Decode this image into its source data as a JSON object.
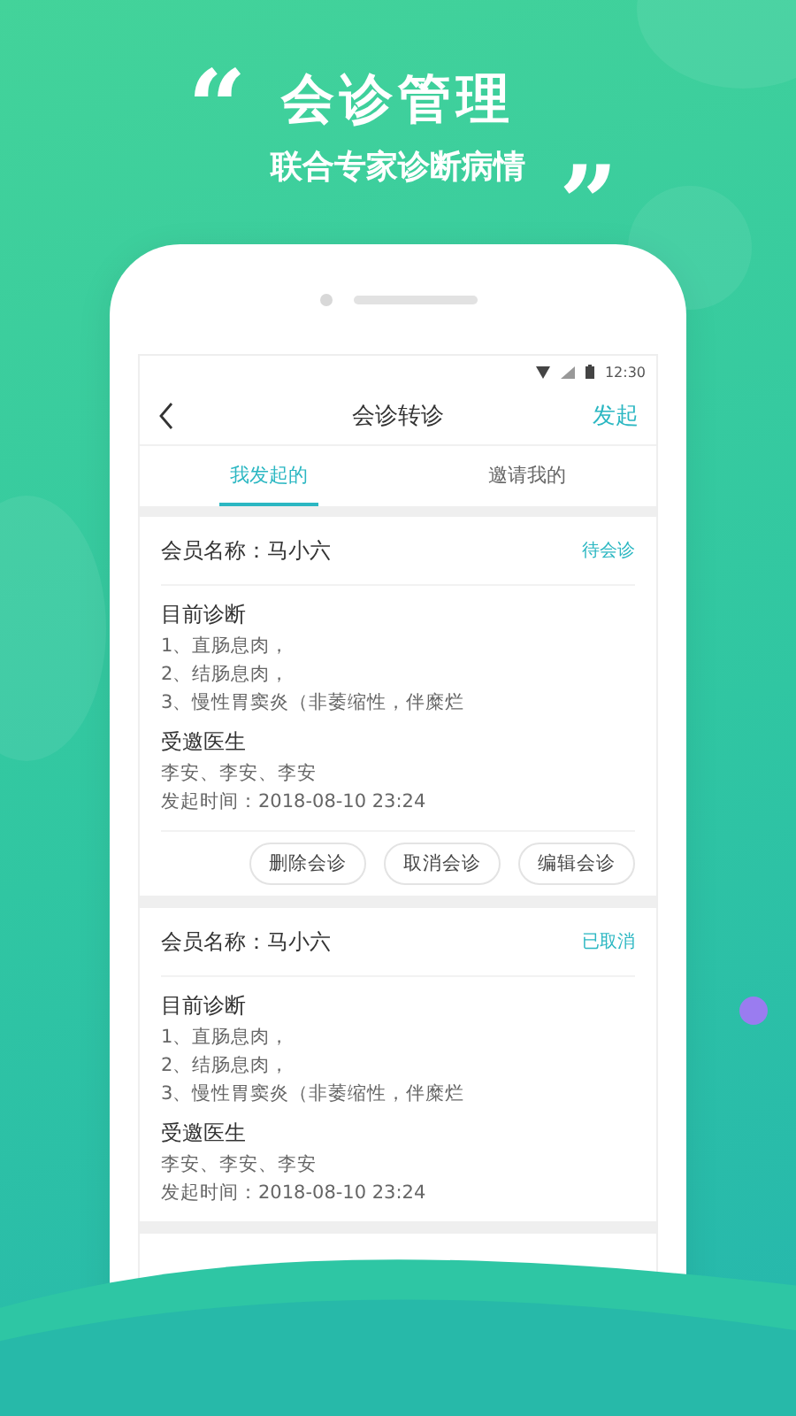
{
  "promo": {
    "open_quote": "“",
    "title": "会诊管理",
    "subtitle": "联合专家诊断病情",
    "close_quote": "”"
  },
  "status_bar": {
    "time": "12:30"
  },
  "nav": {
    "title": "会诊转诊",
    "action": "发起"
  },
  "tabs": [
    {
      "label": "我发起的",
      "selected": true
    },
    {
      "label": "邀请我的",
      "selected": false
    }
  ],
  "cards": [
    {
      "member": "会员名称：马小六",
      "status": "待会诊",
      "diagnosis_heading": "目前诊断",
      "diagnosis": [
        "1、直肠息肉，",
        "2、结肠息肉，",
        "3、慢性胃窦炎（非萎缩性，伴糜烂"
      ],
      "doctors_heading": "受邀医生",
      "doctors": "李安、李安、李安",
      "time": "发起时间：2018-08-10 23:24",
      "buttons": [
        "删除会诊",
        "取消会诊",
        "编辑会诊"
      ]
    },
    {
      "member": "会员名称：马小六",
      "status": "已取消",
      "diagnosis_heading": "目前诊断",
      "diagnosis": [
        "1、直肠息肉，",
        "2、结肠息肉，",
        "3、慢性胃窦炎（非萎缩性，伴糜烂"
      ],
      "doctors_heading": "受邀医生",
      "doctors": "李安、李安、李安",
      "time": "发起时间：2018-08-10 23:24"
    }
  ]
}
